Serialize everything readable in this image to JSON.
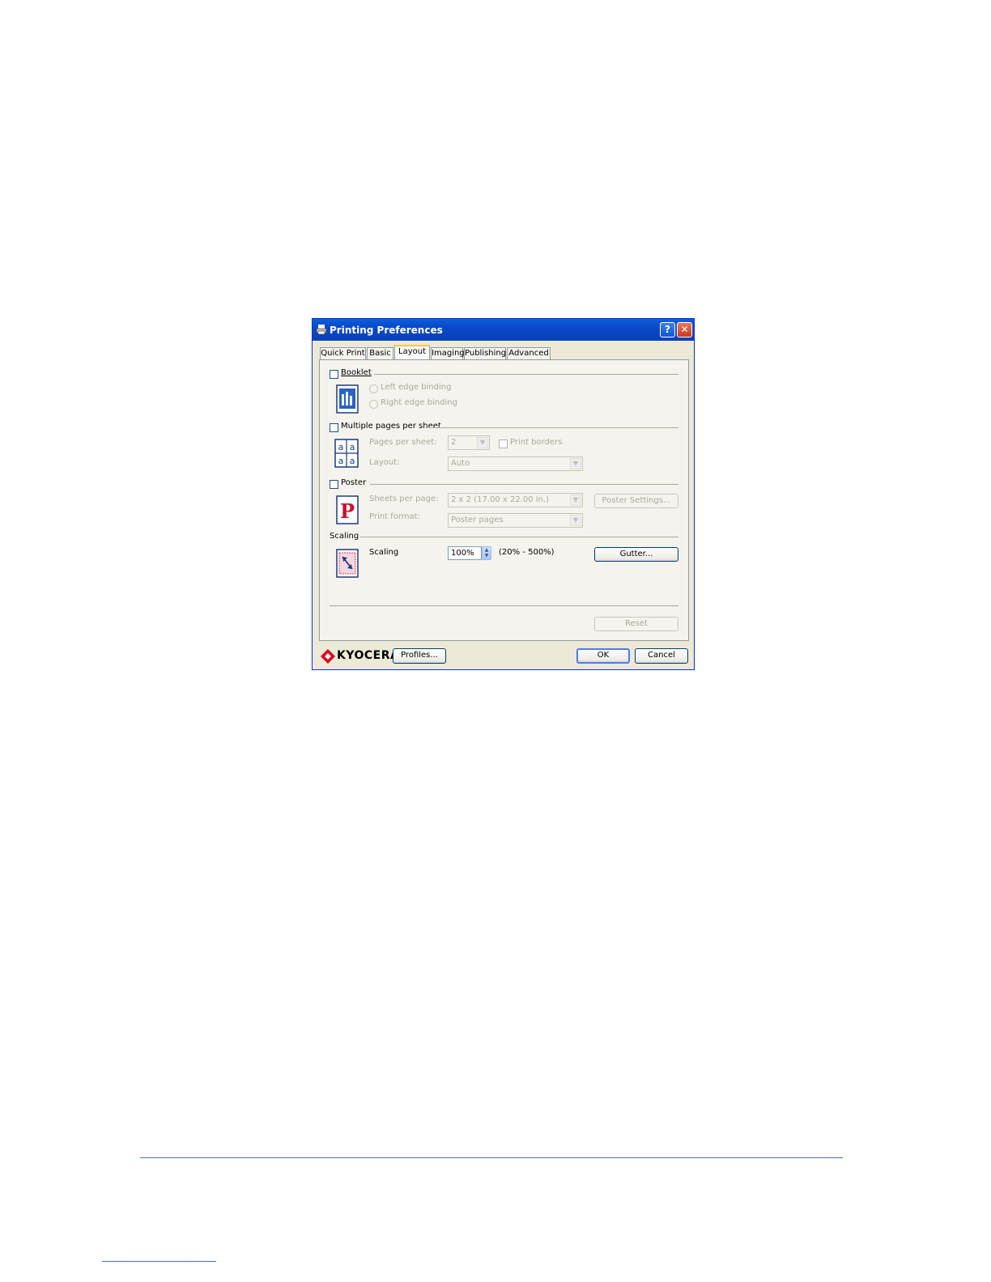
{
  "window": {
    "title": "Printing Preferences",
    "help_label": "?",
    "close_label": "✕"
  },
  "tabs": [
    {
      "label": "Quick Print"
    },
    {
      "label": "Basic"
    },
    {
      "label": "Layout",
      "active": true
    },
    {
      "label": "Imaging"
    },
    {
      "label": "Publishing"
    },
    {
      "label": "Advanced"
    }
  ],
  "booklet": {
    "label": "Booklet",
    "checked": false,
    "left_edge": "Left edge binding",
    "right_edge": "Right edge binding"
  },
  "multiple_pages": {
    "label": "Multiple pages per sheet",
    "checked": false,
    "pages_per_sheet_label": "Pages per sheet:",
    "pages_per_sheet_value": "2",
    "print_borders_label": "Print borders",
    "layout_label": "Layout:",
    "layout_value": "Auto",
    "icon_letter": "a"
  },
  "poster": {
    "label": "Poster",
    "checked": false,
    "sheets_per_page_label": "Sheets per page:",
    "sheets_per_page_value": "2 x 2 (17.00 x 22.00 in.)",
    "print_format_label": "Print format:",
    "print_format_value": "Poster pages",
    "settings_button": "Poster Settings...",
    "icon_letter": "P"
  },
  "scaling": {
    "group_label": "Scaling",
    "label": "Scaling",
    "value": "100%",
    "range": "(20% - 500%)",
    "gutter_button": "Gutter..."
  },
  "reset_button": "Reset",
  "footer": {
    "brand": "KYOCERA",
    "profiles_button": "Profiles...",
    "ok_button": "OK",
    "cancel_button": "Cancel"
  },
  "colors": {
    "titlebar": "#0a48c8",
    "dialog_bg": "#ece9d8",
    "brand_red": "#d8001c",
    "page_rule": "#4472c4"
  }
}
